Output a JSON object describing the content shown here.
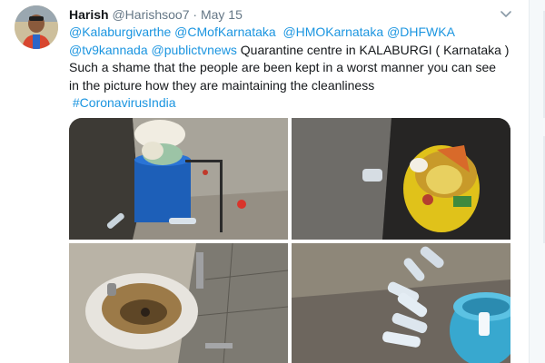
{
  "tweet": {
    "author_name": "Harish",
    "author_handle": "@Harishsoo7",
    "separator": "·",
    "date": "May 15",
    "mentions_line1": [
      "@Kalaburgivarthe",
      "@CMofKarnataka",
      "@HMOKarnataka",
      "@DHFWKA"
    ],
    "mentions_line2": [
      "@tv9kannada",
      "@publictvnews"
    ],
    "text_after_mentions": "Quarantine centre in KALABURGI ( Karnataka )",
    "text_line3": "Such a shame that the people are been kept in a worst manner you can see",
    "text_line4": "in the picture how they are maintaining the cleanliness",
    "hashtag": "#CoronavirusIndia"
  },
  "icons": {
    "avatar": "avatar-photo",
    "caret": "chevron-down-icon"
  },
  "photos": [
    {
      "name": "photo-corner-bin"
    },
    {
      "name": "photo-yellow-bin"
    },
    {
      "name": "photo-dirty-sink"
    },
    {
      "name": "photo-bottles-floor"
    }
  ],
  "colors": {
    "link": "#1b95e0",
    "text": "#14171a",
    "muted": "#657786"
  }
}
